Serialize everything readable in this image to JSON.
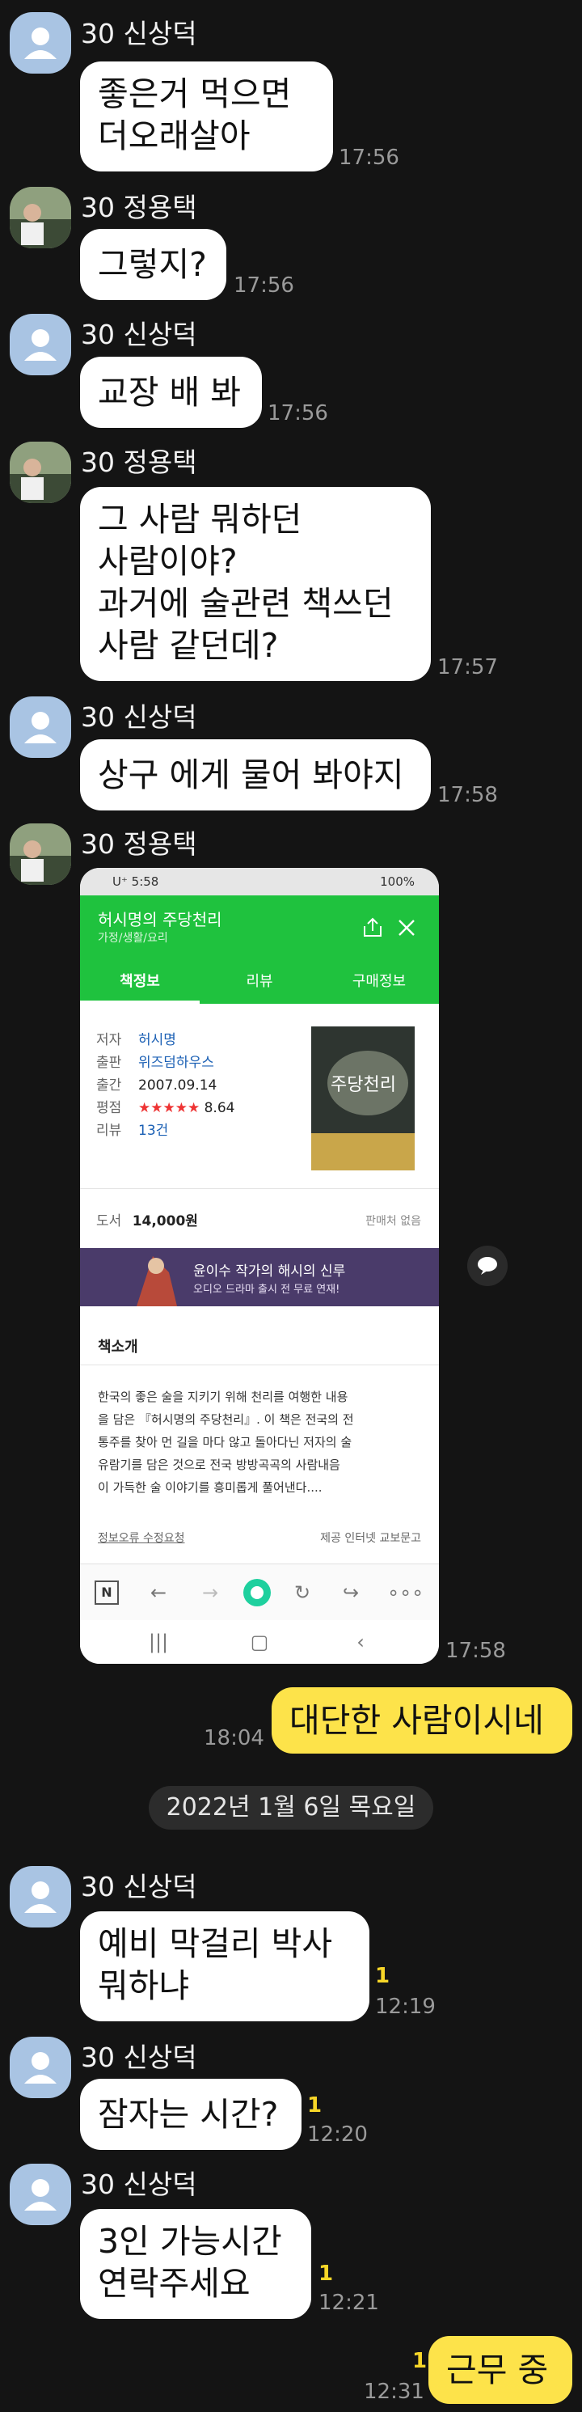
{
  "messages": [
    {
      "sender": "30 신상덕",
      "lines": [
        "좋은거  먹으면",
        "더오래살아"
      ],
      "time": "17:56"
    },
    {
      "sender": "30 정용택",
      "lines": [
        "그렇지?"
      ],
      "time": "17:56"
    },
    {
      "sender": "30 신상덕",
      "lines": [
        "교장 배 봐"
      ],
      "time": "17:56"
    },
    {
      "sender": "30 정용택",
      "lines": [
        "그 사람 뭐하던",
        "사람이야?",
        "과거에 술관련 책쓰던",
        "사람 같던데?"
      ],
      "time": "17:57"
    },
    {
      "sender": "30 신상덕",
      "lines": [
        "상구 에게 물어 봐야지"
      ],
      "time": "17:58"
    },
    {
      "sender": "30 정용택",
      "time": "17:58"
    },
    {
      "lines": [
        "대단한 사람이시네"
      ],
      "time": "18:04"
    },
    {
      "sender": "30 신상덕",
      "lines": [
        "예비 막걸리 박사",
        "뭐하냐"
      ],
      "time": "12:19",
      "unread": "1"
    },
    {
      "sender": "30 신상덕",
      "lines": [
        "잠자는 시간?"
      ],
      "time": "12:20",
      "unread": "1"
    },
    {
      "sender": "30 신상덕",
      "lines": [
        "3인 가능시간",
        "연락주세요"
      ],
      "time": "12:21",
      "unread": "1"
    },
    {
      "lines": [
        "근무 중"
      ],
      "time": "12:31",
      "unread": "1"
    }
  ],
  "date_divider": "2022년 1월 6일 목요일",
  "shot": {
    "status_left": "U⁺ 5:58",
    "status_right": "100%",
    "title": "허시명의 주당천리",
    "subtitle": "가정/생활/요리",
    "tabs": [
      "책정보",
      "리뷰",
      "구매정보"
    ],
    "info": [
      {
        "label": "저자",
        "value": "허시명"
      },
      {
        "label": "출판",
        "value": "위즈덤하우스"
      },
      {
        "label": "출간",
        "value": "2007.09.14"
      },
      {
        "label": "평점",
        "value": "8.64"
      },
      {
        "label": "리뷰",
        "value": "13건"
      }
    ],
    "rating_stars": "★★★★★",
    "price_label": "도서",
    "price": "14,000원",
    "not_for_sale": "판매처 없음",
    "banner_line1": "윤이수 작가의 해시의 신루",
    "banner_line2": "오디오 드라마 출시 전 무료 연재!",
    "intro_title": "책소개",
    "intro_text": [
      "한국의 좋은 술을 지키기 위해 천리를 여행한 내용",
      "을 담은 『허시명의 주당천리』. 이 책은 전국의 전",
      "통주를 찾아 먼 길을 마다 않고 돌아다닌 저자의 술",
      "유람기를 담은 것으로 전국 방방곡곡의 사람내음",
      "이 가득한 술 이야기를 흥미롭게 풀어낸다...."
    ],
    "report_link": "정보오류 수정요청",
    "provider": "제공 인터넷 교보문고",
    "cover_title": "주당천리"
  },
  "colors": {
    "background": "#141414",
    "bubble": "#ffffff",
    "my_bubble": "#fde34a",
    "naver_green": "#1fc23e",
    "unread": "#f7d628"
  }
}
